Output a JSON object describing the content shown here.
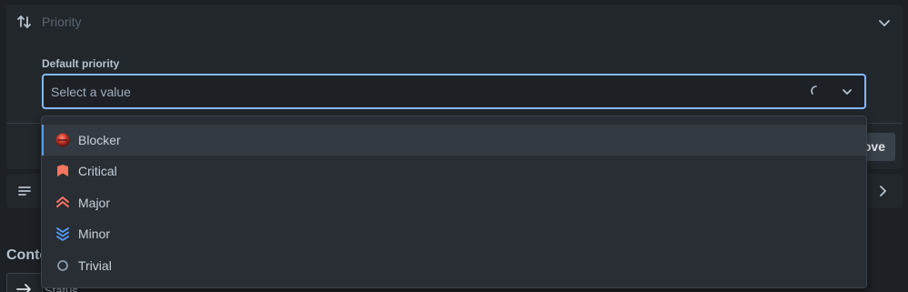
{
  "panel": {
    "title": "Priority",
    "field_label": "Default priority",
    "select_placeholder": "Select a value",
    "save_label": "ove"
  },
  "section": {
    "heading": "Conte",
    "status_label": "Status"
  },
  "menu": {
    "items": [
      {
        "label": "Blocker",
        "icon": "blocker-icon",
        "color": "#e5493a"
      },
      {
        "label": "Critical",
        "icon": "critical-icon",
        "color": "#f87462"
      },
      {
        "label": "Major",
        "icon": "major-icon",
        "color": "#f87462"
      },
      {
        "label": "Minor",
        "icon": "minor-icon",
        "color": "#579dff"
      },
      {
        "label": "Trivial",
        "icon": "trivial-icon",
        "color": "#8c9bab"
      }
    ]
  },
  "colors": {
    "focus": "#85b8ff",
    "accent": "#579dff"
  }
}
